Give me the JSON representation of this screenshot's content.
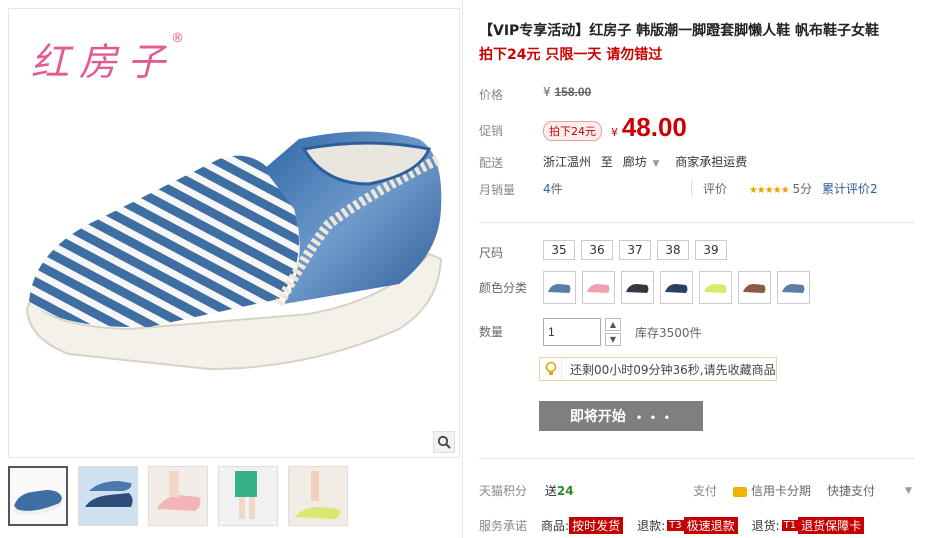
{
  "brand": {
    "logo_text": "红房子",
    "reg_mark": "®"
  },
  "product": {
    "title": "【VIP专享活动】红房子 韩版潮一脚蹬套脚懒人鞋 帆布鞋子女鞋",
    "subtitle": "拍下24元 只限一天 请勿错过"
  },
  "price": {
    "label": "价格",
    "currency": "¥",
    "original": "158.00",
    "promo_label": "促销",
    "promo_tag": "拍下24元",
    "promo_value": "48.00"
  },
  "shipping": {
    "label": "配送",
    "from": "浙江温州",
    "to_word": "至",
    "to": "廊坊",
    "fee": "商家承担运费"
  },
  "sales": {
    "label": "月销量",
    "count": "4",
    "unit": "件",
    "rating_label": "评价",
    "stars": "★★★★★",
    "score": "5分",
    "cumulative": "累计评价2"
  },
  "size": {
    "label": "尺码",
    "options": [
      "35",
      "36",
      "37",
      "38",
      "39"
    ]
  },
  "color": {
    "label": "颜色分类",
    "swatches": [
      "#5a7ea8",
      "#f0a0b0",
      "#333844",
      "#2a3f66",
      "#d8ea70",
      "#8c5a46",
      "#5a7ea8"
    ]
  },
  "quantity": {
    "label": "数量",
    "value": "1",
    "stock": "库存3500件"
  },
  "notice": {
    "text": "还剩00小时09分钟36秒,请先收藏商品"
  },
  "buy": {
    "label": "即将开始",
    "dots": "• • •"
  },
  "points": {
    "label": "天猫积分",
    "prefix": "送",
    "value": "24"
  },
  "payment": {
    "label": "支付",
    "installment": "信用卡分期",
    "quick": "快捷支付"
  },
  "service": {
    "label": "服务承诺",
    "items": [
      {
        "prefix": "商品:",
        "badge": "",
        "name": "按时发货"
      },
      {
        "prefix": "退款:",
        "badge": "T3",
        "name": "极速退款"
      },
      {
        "prefix": "退货:",
        "badge": "T1",
        "name": "退货保障卡"
      }
    ]
  },
  "colors": {
    "accent_red": "#cc0000",
    "link_blue": "#2a5c9e",
    "button_grey": "#7f7f7f",
    "star_gold": "#f0a000"
  }
}
